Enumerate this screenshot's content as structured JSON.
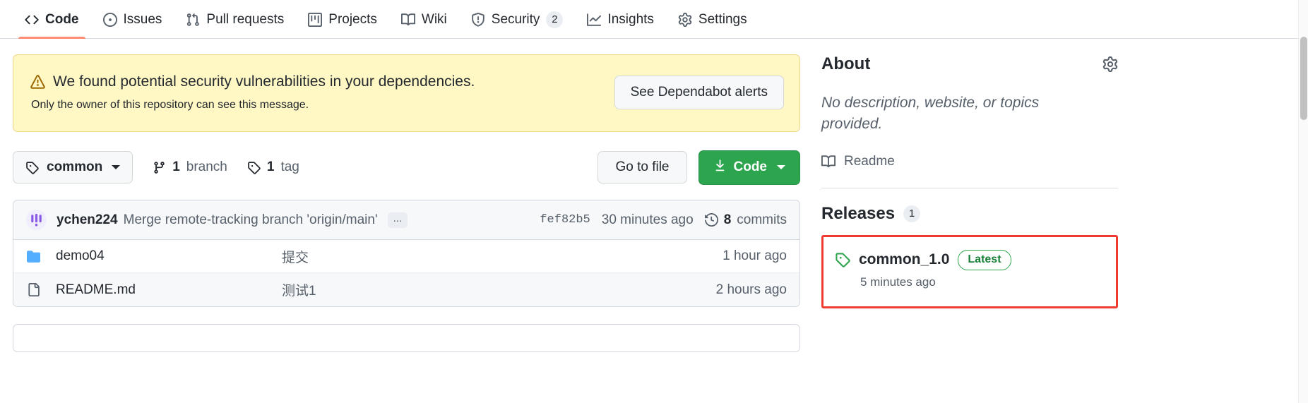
{
  "nav": {
    "items": [
      {
        "label": "Code",
        "icon": "code-icon",
        "active": true,
        "count": null
      },
      {
        "label": "Issues",
        "icon": "issue-icon",
        "active": false,
        "count": null
      },
      {
        "label": "Pull requests",
        "icon": "pr-icon",
        "active": false,
        "count": null
      },
      {
        "label": "Projects",
        "icon": "project-icon",
        "active": false,
        "count": null
      },
      {
        "label": "Wiki",
        "icon": "book-icon",
        "active": false,
        "count": null
      },
      {
        "label": "Security",
        "icon": "shield-icon",
        "active": false,
        "count": "2"
      },
      {
        "label": "Insights",
        "icon": "graph-icon",
        "active": false,
        "count": null
      },
      {
        "label": "Settings",
        "icon": "gear-icon",
        "active": false,
        "count": null
      }
    ]
  },
  "alert": {
    "title": "We found potential security vulnerabilities in your dependencies.",
    "subtitle": "Only the owner of this repository can see this message.",
    "button_label": "See Dependabot alerts",
    "background": "#fff8c5",
    "icon": "warning-icon"
  },
  "toolbar": {
    "branch_label": "common",
    "branch_count": "1",
    "branch_word": "branch",
    "tag_count": "1",
    "tag_word": "tag",
    "go_to_file_label": "Go to file",
    "code_label": "Code",
    "code_button_color": "#2da44e"
  },
  "commit": {
    "author": "ychen224",
    "message": "Merge remote-tracking branch 'origin/main'",
    "expand_label": "...",
    "sha": "fef82b5",
    "time": "30 minutes ago",
    "commits_count": "8",
    "commits_word": "commits"
  },
  "files": [
    {
      "name": "demo04",
      "type": "folder",
      "commit": "提交",
      "age": "1 hour ago"
    },
    {
      "name": "README.md",
      "type": "file",
      "commit": "测试1",
      "age": "2 hours ago"
    }
  ],
  "about": {
    "title": "About",
    "description": "No description, website, or topics provided.",
    "readme_label": "Readme",
    "settings_icon": "gear-icon"
  },
  "releases": {
    "title": "Releases",
    "count": "1",
    "highlight_color": "#ef3b32",
    "item": {
      "name": "common_1.0",
      "badge": "Latest",
      "time": "5 minutes ago",
      "icon": "tag-icon"
    }
  }
}
